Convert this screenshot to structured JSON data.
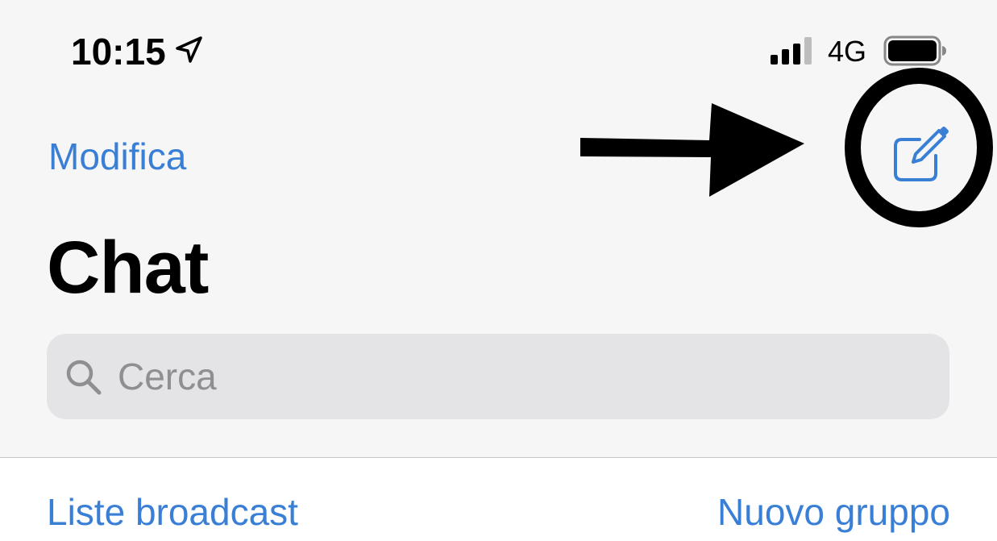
{
  "status_bar": {
    "time": "10:15",
    "network": "4G",
    "icons": [
      "location-arrow-icon",
      "cellular-signal-icon",
      "battery-icon"
    ]
  },
  "nav": {
    "edit_label": "Modifica",
    "compose_icon": "compose-icon"
  },
  "header": {
    "title": "Chat"
  },
  "search": {
    "placeholder": "Cerca",
    "icon": "search-icon"
  },
  "actions": {
    "broadcast_label": "Liste broadcast",
    "new_group_label": "Nuovo gruppo"
  },
  "annotations": {
    "items": [
      "arrow-pointer",
      "circle-highlight"
    ]
  },
  "colors": {
    "accent": "#3a7fd6",
    "background": "#f6f6f6",
    "search_field": "#e4e4e6",
    "placeholder": "#8e8e93",
    "annotation": "#000000"
  }
}
